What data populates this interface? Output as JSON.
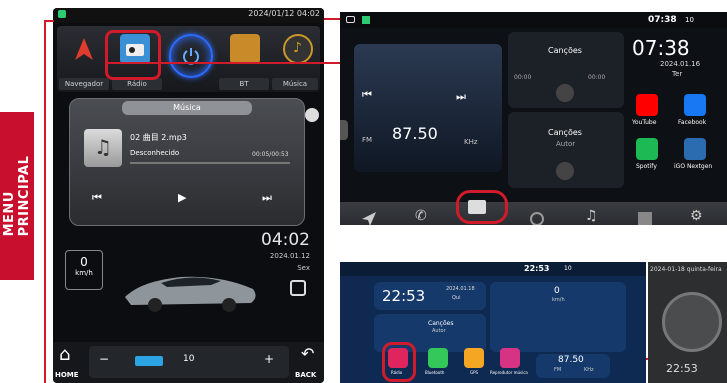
{
  "side_tag": "MENU PRINCIPAL",
  "left": {
    "status_date": "2024/01/12 04:02",
    "dock": [
      {
        "label": "Navegador",
        "icon": "navigation-arrow-icon"
      },
      {
        "label": "Rádio",
        "icon": "radio-icon"
      },
      {
        "label": "",
        "icon": "power-icon"
      },
      {
        "label": "BT",
        "icon": "phone-book-icon"
      },
      {
        "label": "Música",
        "icon": "music-icon"
      }
    ],
    "music": {
      "tab": "Música",
      "track": "02 曲目 2.mp3",
      "artist": "Desconhecido",
      "time": "00:05/00:53"
    },
    "speed_value": "0",
    "speed_unit": "km/h",
    "clock": "04:02",
    "date": "2024.01.12",
    "weekday": "Sex",
    "home_label": "HOME",
    "back_label": "BACK",
    "volume": "10",
    "volume_minus": "−",
    "volume_plus": "+"
  },
  "right_top": {
    "status_time": "07:38",
    "status_volume": "10",
    "radio_freq": "87.50",
    "radio_band": "FM",
    "radio_unit": "KHz",
    "card1_title": "Canções",
    "card1_time_a": "00:00",
    "card1_time_b": "00:00",
    "card2_title": "Canções",
    "card2_sub": "Autor",
    "clock": "07:38",
    "date": "2024.01.16",
    "weekday": "Ter",
    "apps": [
      {
        "label": "YouTube",
        "color": "#ff0000"
      },
      {
        "label": "Facebook",
        "color": "#1877f2"
      },
      {
        "label": "Spotify",
        "color": "#1db954"
      },
      {
        "label": "iGO Nextgen",
        "color": "#2b6cb0"
      }
    ]
  },
  "right_bottom": {
    "status_time": "22:53",
    "status_volume": "10",
    "clock": "22:53",
    "date": "2024.01.18",
    "weekday": "Qui",
    "card_title": "Canções",
    "card_sub": "Autor",
    "speed_value": "0",
    "speed_unit": "km/h",
    "freq": "87.50",
    "freq_band": "FM",
    "freq_unit": "KHz",
    "apps": [
      {
        "label": "Rádio",
        "color": "#e0245e"
      },
      {
        "label": "Bluetooth",
        "color": "#34c759"
      },
      {
        "label": "GPS",
        "color": "#f5a623"
      },
      {
        "label": "Reprodutor música",
        "color": "#d63384"
      }
    ],
    "side_date": "2024-01-18 quinta-feira",
    "side_clock": "22:53"
  }
}
